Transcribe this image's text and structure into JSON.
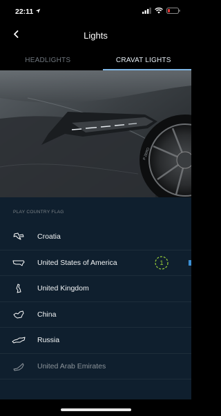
{
  "status_bar": {
    "time": "22:11"
  },
  "nav": {
    "title": "Lights"
  },
  "tabs": [
    {
      "label": "HEADLIGHTS",
      "active": false
    },
    {
      "label": "CRAVAT LIGHTS",
      "active": true
    }
  ],
  "section": {
    "header": "PLAY COUNTRY FLAG"
  },
  "flags": [
    {
      "label": "Croatia",
      "icon": "croatia-map-icon"
    },
    {
      "label": "United States of America",
      "icon": "usa-map-icon",
      "timer": "1"
    },
    {
      "label": "United Kingdom",
      "icon": "uk-map-icon"
    },
    {
      "label": "China",
      "icon": "china-map-icon"
    },
    {
      "label": "Russia",
      "icon": "russia-map-icon"
    },
    {
      "label": "United Arab Emirates",
      "icon": "uae-map-icon"
    }
  ],
  "colors": {
    "background": "#000000",
    "list_background": "#0f1f2e",
    "active_tab_underline": "#7fb7e6",
    "timer_green": "#9bd13a",
    "play_marker_blue": "#3b8fd4"
  }
}
